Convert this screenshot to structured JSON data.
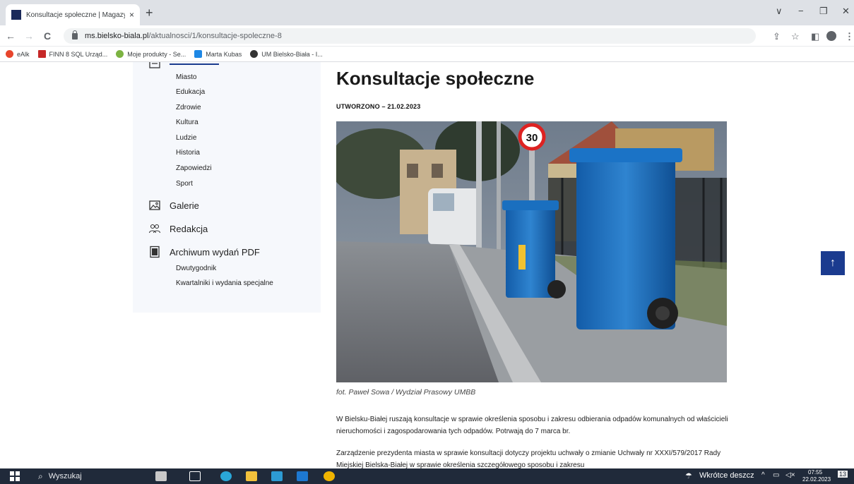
{
  "browser": {
    "tab_title": "Konsultacje społeczne | Magazyn",
    "tab_close": "×",
    "new_tab": "+",
    "url_host": "ms.bielsko-biala.pl",
    "url_path": "/aktualnosci/1/konsultacje-spoleczne-8",
    "nav": {
      "back": "←",
      "forward": "→",
      "reload": "C"
    },
    "window": {
      "minimize_collapse": "∨",
      "minimize": "−",
      "restore": "❐",
      "close": "✕"
    },
    "right_icons": {
      "share": "⇪",
      "star": "☆",
      "panel": "◧",
      "menu": "⋮"
    },
    "bookmarks": [
      {
        "label": "eAlk",
        "color": "#e8452c"
      },
      {
        "label": "FINN 8 SQL Urząd...",
        "color": "#c62828"
      },
      {
        "label": "Moje produkty - Se...",
        "color": "#7cb342"
      },
      {
        "label": "Marta Kubas",
        "color": "#1e88e5"
      },
      {
        "label": "UM Bielsko-Biała - I...",
        "color": "#333333"
      }
    ]
  },
  "sidebar": {
    "wiadomosci_items": [
      "Miasto",
      "Edukacja",
      "Zdrowie",
      "Kultura",
      "Ludzie",
      "Historia",
      "Zapowiedzi",
      "Sport"
    ],
    "galerie": "Galerie",
    "redakcja": "Redakcja",
    "archiwum": "Archiwum wydań PDF",
    "archiwum_items": [
      "Dwutygodnik",
      "Kwartalniki i wydania specjalne"
    ]
  },
  "article": {
    "title": "Konsultacje społeczne",
    "created": "UTWORZONO – 21.02.2023",
    "caption": "fot. Paweł Sowa / Wydział Prasowy UMBB",
    "paragraph1": "W Bielsku-Białej ruszają konsultacje w sprawie określenia sposobu i zakresu odbierania odpadów komunalnych od właścicieli nieruchomości i zagospodarowania tych odpadów. Potrwają do 7 marca br.",
    "paragraph2": "Zarządzenie prezydenta miasta w sprawie konsultacji dotyczy projektu uchwały o zmianie Uchwały nr XXXI/579/2017 Rady Miejskiej Bielska-Białej w sprawie określenia szczegółowego sposobu i zakresu",
    "speed_sign": "30"
  },
  "scroll_top": "↑",
  "taskbar": {
    "search_placeholder": "Wyszukaj",
    "weather": "Wkrótce deszcz",
    "time": "07:55",
    "date": "22.02.2023",
    "tray_arrow": "^",
    "tray_sound": "◁×",
    "notif_count": "13"
  }
}
